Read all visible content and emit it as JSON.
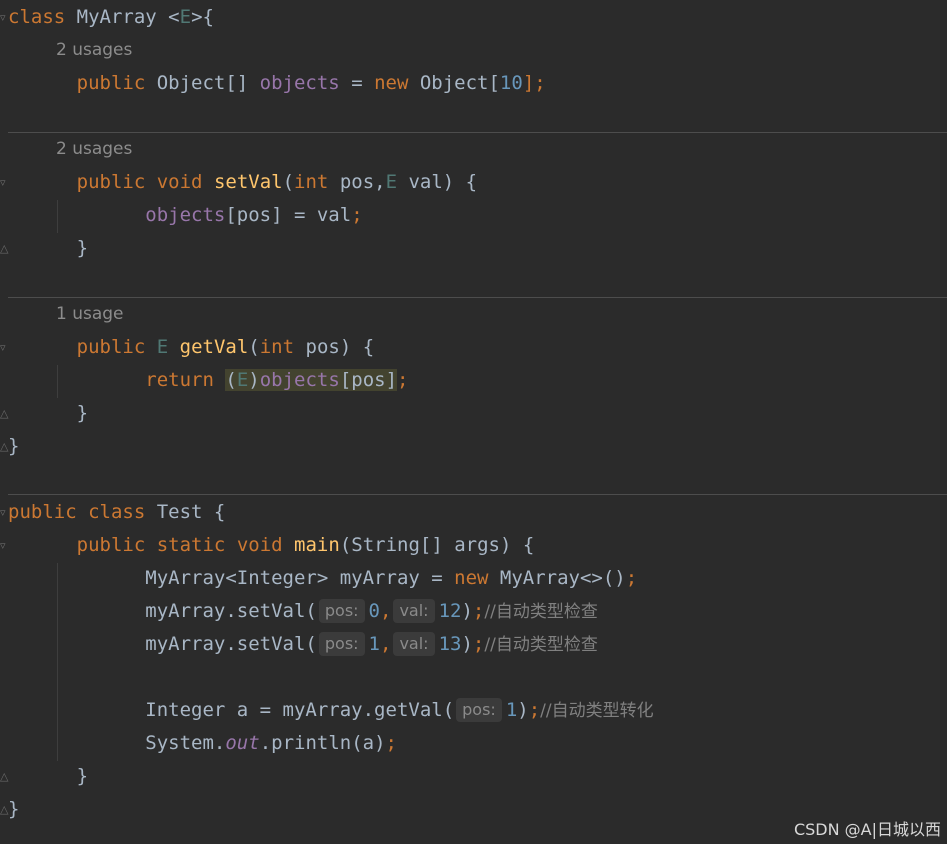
{
  "usage_hints": {
    "objects_field": "2 usages",
    "set_val": "2 usages",
    "get_val": "1 usage"
  },
  "code": {
    "class_decl": {
      "kw": "class",
      "name": "MyArray",
      "open": " <",
      "type_param": "E",
      "close": ">{"
    },
    "field_decl": {
      "kw": "public",
      "type": " Object[] ",
      "field": "objects",
      "eq": " = ",
      "new_kw": "new",
      "ctor": " Object[",
      "size": "10",
      "end": "];"
    },
    "setval_decl": {
      "kw1": "public",
      "kw2": "void",
      "name": "setVal",
      "p_open": "(",
      "int_kw": "int",
      "p1": " pos,",
      "e_type": "E",
      "p2": " val) {"
    },
    "setval_body": {
      "field": "objects",
      "rest": "[pos] = val",
      "semi": ";"
    },
    "getval_decl": {
      "kw": "public",
      "e_type": "E",
      "name": "getVal",
      "p_open": "(",
      "int_kw": "int",
      "rest": " pos) {"
    },
    "getval_body": {
      "kw": "return",
      "cast_open": "(",
      "cast_type": "E",
      "cast_close": ")",
      "field": "objects",
      "idx": "[pos]",
      "semi": ";"
    },
    "close_brace": "}",
    "test_decl": {
      "kw1": "public",
      "kw2": "class",
      "rest": " Test {"
    },
    "main_decl": {
      "kw1": "public",
      "kw2": "static",
      "kw3": "void",
      "name": "main",
      "rest": "(String[] args) {"
    },
    "line_new": {
      "lhs": "MyArray<Integer> myArray = ",
      "new_kw": "new",
      "rhs": " MyArray<>()",
      "semi": ";"
    },
    "line_set1": {
      "call": "myArray.setVal(",
      "h1": "pos:",
      "v1": "0",
      "comma": ",",
      "h2": "val:",
      "v2": "12",
      "close": ")",
      "semi": ";",
      "comment": "//自动类型检查"
    },
    "line_set2": {
      "call": "myArray.setVal(",
      "h1": "pos:",
      "v1": "1",
      "comma": ",",
      "h2": "val:",
      "v2": "13",
      "close": ")",
      "semi": ";",
      "comment": "//自动类型检查"
    },
    "line_get": {
      "lhs": "Integer a = myArray.getVal(",
      "h1": "pos:",
      "v1": "1",
      "close": ")",
      "semi": ";",
      "comment": "//自动类型转化"
    },
    "line_print": {
      "pre": "System.",
      "field": "out",
      "post": ".println(a)",
      "semi": ";"
    }
  },
  "watermark": "CSDN @A|日城以西",
  "colors": {
    "background": "#2b2b2b",
    "keyword": "#cc7832",
    "field": "#9876aa",
    "number": "#6897bb",
    "method": "#ffc66d",
    "type_param": "#507874",
    "comment": "#808080",
    "plain": "#a9b7c6"
  }
}
